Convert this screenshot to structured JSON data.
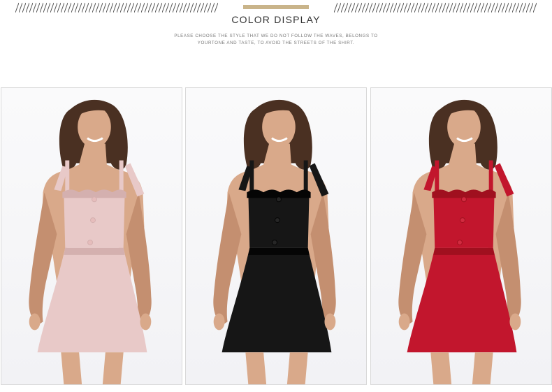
{
  "header": {
    "title": "COLOR DISPLAY",
    "subtitle_line1": "PLEASE CHOOSE THE STYLE THAT WE DO NOT FOLLOW THE WAVES, BELONGS TO",
    "subtitle_line2": "YOURTONE AND TASTE, TO AVOID THE STREETS OF THE SHIRT.",
    "accent_color": "#c9b48a",
    "hatch_color": "#555555"
  },
  "products": [
    {
      "color_name": "pink",
      "dress_color": "#e8c9c8",
      "dress_shade": "#d4b0af",
      "button_color": "#e6bdbc"
    },
    {
      "color_name": "black",
      "dress_color": "#161616",
      "dress_shade": "#050505",
      "button_color": "#262626"
    },
    {
      "color_name": "red",
      "dress_color": "#c2162d",
      "dress_shade": "#a0101f",
      "button_color": "#d12a3f"
    }
  ]
}
